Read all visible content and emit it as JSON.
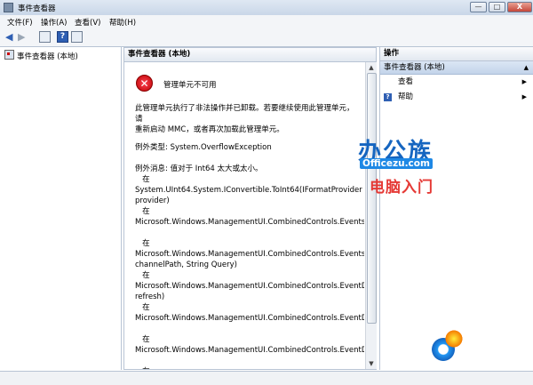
{
  "window": {
    "title": "事件查看器",
    "buttons": {
      "minimize": "—",
      "maximize": "□",
      "close": "X"
    }
  },
  "menu": [
    "文件(F)",
    "操作(A)",
    "查看(V)",
    "帮助(H)"
  ],
  "toolbar": {
    "icons": [
      "back-icon",
      "forward-icon",
      "show-hide-tree-icon",
      "help-icon",
      "show-hide-actions-icon"
    ],
    "help_glyph": "?"
  },
  "tree": {
    "root": "事件查看器 (本地)"
  },
  "center": {
    "header": "事件查看器 (本地)",
    "error_title": "管理单元不可用",
    "error_glyph": "✕",
    "message_line1": "此管理单元执行了非法操作并已卸载。若要继续使用此管理单元，请",
    "message_line2": "重新启动 MMC，或者再次加载此管理单元。",
    "trace": "例外类型: System.OverflowException\n\n例外消息: 值对于 Int64 太大或太小。\n   在\nSystem.UInt64.System.IConvertible.ToInt64(IFormatProvider\nprovider)\n   在\nMicrosoft.Windows.ManagementUI.CombinedControls.EventsRe\n\n   在\nMicrosoft.Windows.ManagementUI.CombinedControls.EventsRe\nchannelPath, String Query)\n   在\nMicrosoft.Windows.ManagementUI.CombinedControls.EventDe\nrefresh)\n   在\nMicrosoft.Windows.ManagementUI.CombinedControls.EventDe\n\n   在\nMicrosoft.Windows.ManagementUI.CombinedControls.EventDe\n\n   在"
  },
  "actions": {
    "header": "操作",
    "section": "事件查看器 (本地)",
    "collapse_glyph": "▲",
    "items": [
      {
        "label": "查看",
        "arrow": "▶"
      },
      {
        "label": "帮助",
        "arrow": "▶",
        "icon": "?"
      }
    ]
  },
  "watermark": {
    "logo": "办公族",
    "url": "Officezu.com",
    "subtitle": "电脑入门"
  },
  "colors": {
    "accent": "#2f5fb3",
    "pane_header": "#e2e8f0",
    "section_bg": "#c3d4ea"
  }
}
